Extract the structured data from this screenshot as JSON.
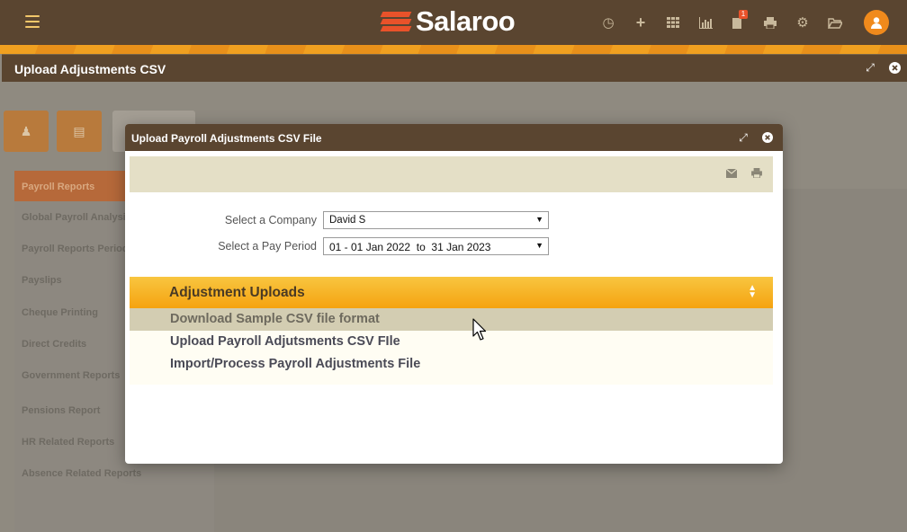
{
  "app": {
    "brand": "Salaroo",
    "notification_count": "1"
  },
  "top_icons": [
    "clock-icon",
    "plus-icon",
    "grid-icon",
    "bar-chart-icon",
    "documents-icon",
    "print-icon",
    "gear-icon",
    "folder-open-icon"
  ],
  "outer_window": {
    "title": "Upload Adjustments CSV"
  },
  "background_menu": {
    "items": [
      "Payroll Reports",
      "Global Payroll Analysis",
      "Payroll Reports Period",
      "Payslips",
      "Cheque Printing",
      "Direct Credits",
      "Government Reports",
      "Pensions Report",
      "HR Related Reports",
      "Absence Related Reports"
    ]
  },
  "modal": {
    "title": "Upload Payroll Adjustments CSV File",
    "company_label": "Select a Company",
    "company_value": "David S",
    "period_label": "Select a Pay Period",
    "period_value": "01 - 01 Jan 2022  to  31 Jan 2023",
    "accordion": {
      "title": "Adjustment Uploads",
      "items": [
        "Download Sample CSV file format",
        "Upload Payroll Adjutsments CSV FIle",
        "Import/Process Payroll Adjustments File"
      ]
    }
  },
  "colors": {
    "header_brown": "#5a4530",
    "accent_orange": "#f08a1c",
    "accordion_gold": "#f5a310",
    "hover_row": "#d3cdb2"
  }
}
